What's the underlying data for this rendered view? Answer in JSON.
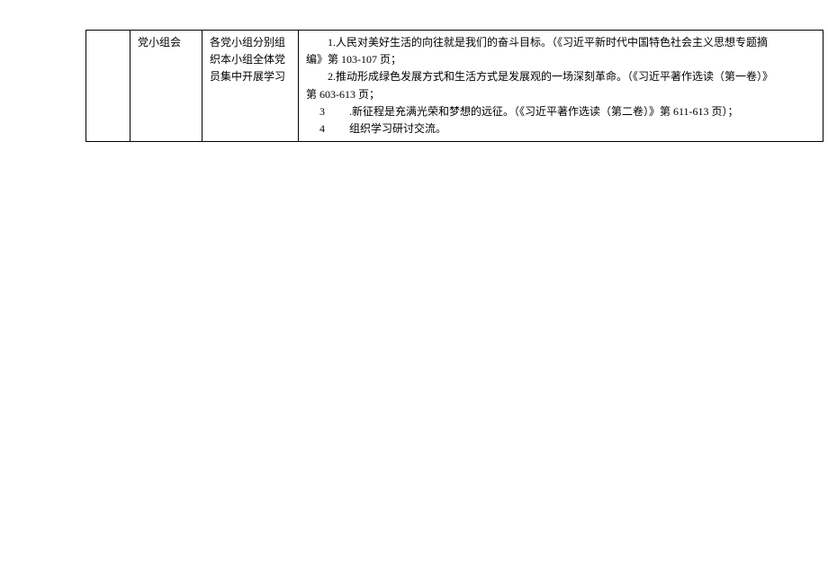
{
  "table": {
    "row": {
      "col2": "党小组会",
      "col3": "各党小组分别组织本小组全体党员集中开展学习",
      "col4": {
        "line1": "1.人民对美好生活的向往就是我们的奋斗目标。（《习近平新时代中国特色社会主义思想专题摘",
        "line2": "编》第 103-107 页；",
        "line3": "2.推动形成绿色发展方式和生活方式是发展观的一场深刻革命。（《习近平著作选读（第一卷）》",
        "line4": "第 603-613 页；",
        "item3_num": "3",
        "item3_text": ".新征程是充满光荣和梦想的远征。（《习近平著作选读（第二卷）》第 611-613 页）；",
        "item4_num": "4",
        "item4_text": "组织学习研讨交流。"
      }
    }
  }
}
